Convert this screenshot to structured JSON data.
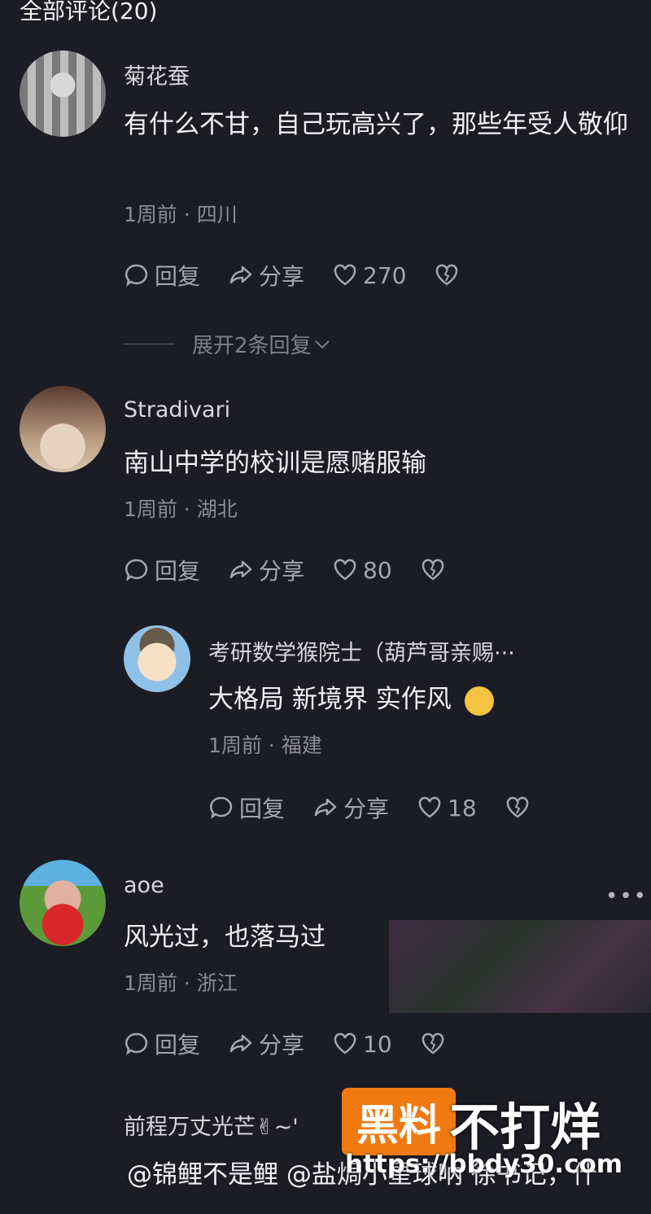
{
  "header": {
    "title": "全部评论(20)"
  },
  "comments": [
    {
      "user": "菊花蚕",
      "text": "有什么不甘，自己玩高兴了，那些年受人敬仰",
      "time_loc": "1周前 · 四川",
      "reply_label": "回复",
      "share_label": "分享",
      "likes": "270",
      "expand": "展开2条回复"
    },
    {
      "user": "Stradivari",
      "text": "南山中学的校训是愿赌服输",
      "time_loc": "1周前 · 湖北",
      "reply_label": "回复",
      "share_label": "分享",
      "likes": "80"
    },
    {
      "user": "aoe",
      "text": "风光过，也落马过",
      "time_loc": "1周前 · 浙江",
      "reply_label": "回复",
      "share_label": "分享",
      "likes": "10",
      "more": "•••"
    }
  ],
  "reply": {
    "user": "考研数学猴院士（葫芦哥亲赐···",
    "text": "大格局 新境界 实作风",
    "time_loc": "1周前 · 福建",
    "reply_label": "回复",
    "share_label": "分享",
    "likes": "18"
  },
  "partial": {
    "user": "前程万丈光芒✌~'",
    "text": "@锦鲤不是鲤 @盐焗小星球呐 徐书记，什"
  },
  "watermark": {
    "box": "黑料",
    "text": "不打烊",
    "url": "https://bbdy30.com"
  },
  "colors": {
    "background": "#1c1c24",
    "accent": "#f07a10"
  }
}
